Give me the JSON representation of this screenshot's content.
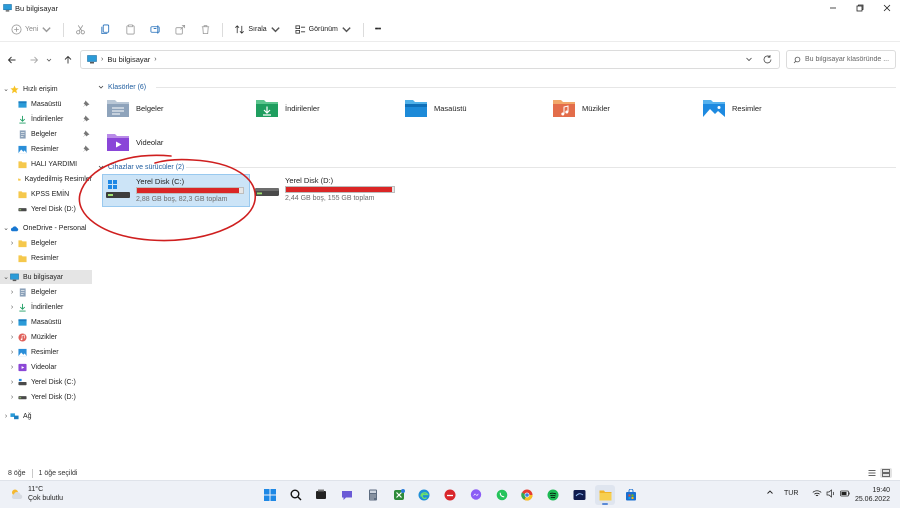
{
  "window": {
    "title": "Bu bilgisayar"
  },
  "toolbar": {
    "new_label": "Yeni",
    "sort_label": "Sırala",
    "view_label": "Görünüm",
    "more_label": "•••"
  },
  "address": {
    "crumb": "Bu bilgisayar",
    "search_placeholder": "Bu bilgisayar klasöründe ..."
  },
  "nav": {
    "quick_access": "Hızlı erişim",
    "quick_items": [
      "Masaüstü",
      "İndirilenler",
      "Belgeler",
      "Resimler",
      "HALI YARDIMI",
      "Kaydedilmiş Resimler",
      "KPSS EMİN",
      "Yerel Disk (D:)"
    ],
    "onedrive": "OneDrive - Personal",
    "onedrive_items": [
      "Belgeler",
      "Resimler"
    ],
    "this_pc": "Bu bilgisayar",
    "pc_items": [
      "Belgeler",
      "İndirilenler",
      "Masaüstü",
      "Müzikler",
      "Resimler",
      "Videolar",
      "Yerel Disk (C:)",
      "Yerel Disk (D:)"
    ],
    "network": "Ağ"
  },
  "content": {
    "folders_header": "Klasörler (6)",
    "folders": [
      "Belgeler",
      "İndirilenler",
      "Masaüstü",
      "Müzikler",
      "Resimler",
      "Videolar"
    ],
    "drives_header": "Cihazlar ve sürücüler (2)",
    "drives": [
      {
        "name": "Yerel Disk (C:)",
        "info": "2,88 GB boş, 82,3 GB toplam",
        "used_fraction": 0.965
      },
      {
        "name": "Yerel Disk (D:)",
        "info": "2,44 GB boş, 155 GB toplam",
        "used_fraction": 0.984
      }
    ]
  },
  "status": {
    "items": "8 öğe",
    "selected": "1 öğe seçildi"
  },
  "taskbar": {
    "temp": "11°C",
    "condition": "Çok bulutlu",
    "lang": "TUR",
    "time": "19:40",
    "date": "25.06.2022"
  },
  "colors": {
    "accent": "#0078d4",
    "drive_bar": "#da2626",
    "selection": "#cce4f7",
    "folder_yellow": "#f5c84c",
    "annotation_red": "#cf1f1f"
  }
}
